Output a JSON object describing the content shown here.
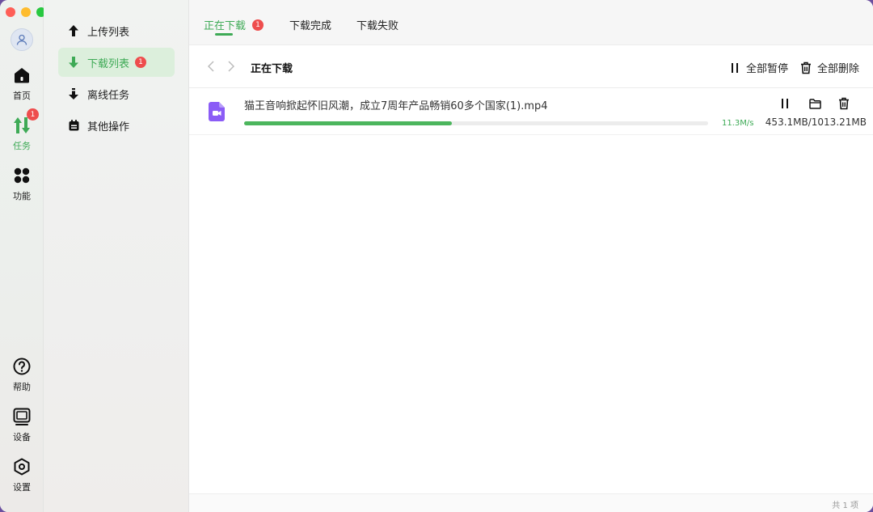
{
  "rail": {
    "items": [
      {
        "label": "首页",
        "icon": "home-icon"
      },
      {
        "label": "任务",
        "icon": "transfer-icon",
        "badge": "1"
      },
      {
        "label": "功能",
        "icon": "apps-icon"
      },
      {
        "label": "帮助",
        "icon": "help-icon"
      },
      {
        "label": "设备",
        "icon": "device-icon"
      },
      {
        "label": "设置",
        "icon": "settings-icon"
      }
    ]
  },
  "sidebar": {
    "items": [
      {
        "label": "上传列表",
        "icon": "upload-icon"
      },
      {
        "label": "下载列表",
        "icon": "download-icon",
        "badge": "1"
      },
      {
        "label": "离线任务",
        "icon": "offline-download-icon"
      },
      {
        "label": "其他操作",
        "icon": "calendar-icon"
      }
    ]
  },
  "tabs": [
    {
      "label": "正在下载",
      "badge": "1"
    },
    {
      "label": "下载完成"
    },
    {
      "label": "下载失败"
    }
  ],
  "toolbar": {
    "title": "正在下载",
    "pause_all": "全部暂停",
    "delete_all": "全部删除"
  },
  "downloads": [
    {
      "name": "猫王音响掀起怀旧风潮，成立7周年产品畅销60多个国家(1).mp4",
      "speed": "11.3M/s",
      "size": "453.1MB/1013.21MB",
      "progress": 0.447
    }
  ],
  "footer": {
    "count": "共 1 项"
  },
  "colors": {
    "accent": "#3eaa56",
    "badge": "#ee4d4d",
    "file_icon": "#8b5cf6"
  }
}
